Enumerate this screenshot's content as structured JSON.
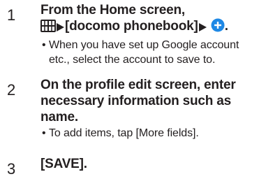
{
  "steps": [
    {
      "number": "1",
      "title_line1": "From the Home screen,",
      "title_line2_part1": "[docomo phonebook]",
      "title_line2_end": ".",
      "notes": [
        {
          "line1": "When you have set up Google account",
          "line2": "etc., select the account to save to."
        }
      ]
    },
    {
      "number": "2",
      "title_line1": "On the profile edit screen, enter",
      "title_line2": "necessary information such as",
      "title_line3": "name.",
      "notes": [
        {
          "line1": "To add items, tap [More fields]."
        }
      ]
    },
    {
      "number": "3",
      "title_line1": "[SAVE]."
    }
  ],
  "icons": {
    "apps": "apps-grid-icon",
    "arrow": "triangle-right-icon",
    "add": "add-circle-icon"
  },
  "colors": {
    "text": "#231f20",
    "add_icon": "#1e88e5"
  }
}
